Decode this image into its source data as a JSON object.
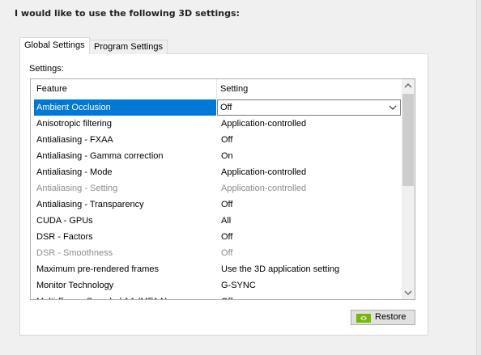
{
  "heading": "I would like to use the following 3D settings:",
  "tabs": [
    {
      "label": "Global Settings",
      "active": true
    },
    {
      "label": "Program Settings",
      "active": false
    }
  ],
  "settings_label": "Settings:",
  "table": {
    "columns": [
      "Feature",
      "Setting"
    ],
    "rows": [
      {
        "feature": "Ambient Occlusion",
        "setting": "Off",
        "selected": true,
        "disabled": false
      },
      {
        "feature": "Anisotropic filtering",
        "setting": "Application-controlled",
        "disabled": false
      },
      {
        "feature": "Antialiasing - FXAA",
        "setting": "Off",
        "disabled": false
      },
      {
        "feature": "Antialiasing - Gamma correction",
        "setting": "On",
        "disabled": false
      },
      {
        "feature": "Antialiasing - Mode",
        "setting": "Application-controlled",
        "disabled": false
      },
      {
        "feature": "Antialiasing - Setting",
        "setting": "Application-controlled",
        "disabled": true
      },
      {
        "feature": "Antialiasing - Transparency",
        "setting": "Off",
        "disabled": false
      },
      {
        "feature": "CUDA - GPUs",
        "setting": "All",
        "disabled": false
      },
      {
        "feature": "DSR - Factors",
        "setting": "Off",
        "disabled": false
      },
      {
        "feature": "DSR - Smoothness",
        "setting": "Off",
        "disabled": true
      },
      {
        "feature": "Maximum pre-rendered frames",
        "setting": "Use the 3D application setting",
        "disabled": false
      },
      {
        "feature": "Monitor Technology",
        "setting": "G-SYNC",
        "disabled": false
      },
      {
        "feature": "Multi-Frame Sampled AA (MFAA)",
        "setting": "Off",
        "disabled": false
      }
    ]
  },
  "restore_button": {
    "label": "Restore",
    "icon": "nvidia-logo-icon"
  },
  "colors": {
    "selection": "#0078d7",
    "disabled_text": "#8c8c8c",
    "nvidia_green": "#76b900"
  }
}
